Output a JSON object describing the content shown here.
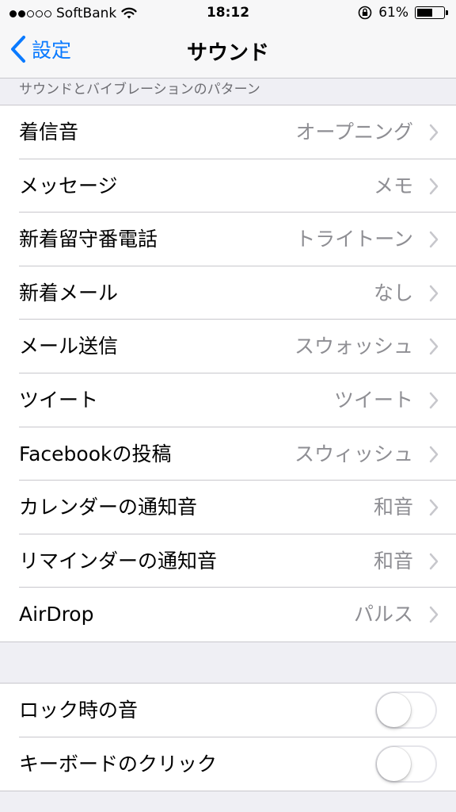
{
  "status_bar": {
    "signal_dots": [
      true,
      true,
      false,
      false,
      false
    ],
    "carrier": "SoftBank",
    "time": "18:12",
    "battery_percent": "61%",
    "battery_level": 0.61,
    "icons": [
      "wifi-icon",
      "rotation-lock-icon",
      "battery-icon"
    ]
  },
  "nav": {
    "back_label": "設定",
    "title": "サウンド"
  },
  "section_header": "サウンドとバイブレーションのパターン",
  "sound_rows": [
    {
      "label": "着信音",
      "value": "オープニング"
    },
    {
      "label": "メッセージ",
      "value": "メモ"
    },
    {
      "label": "新着留守番電話",
      "value": "トライトーン"
    },
    {
      "label": "新着メール",
      "value": "なし"
    },
    {
      "label": "メール送信",
      "value": "スウォッシュ"
    },
    {
      "label": "ツイート",
      "value": "ツイート"
    },
    {
      "label": "Facebookの投稿",
      "value": "スウィッシュ"
    },
    {
      "label": "カレンダーの通知音",
      "value": "和音"
    },
    {
      "label": "リマインダーの通知音",
      "value": "和音"
    },
    {
      "label": "AirDrop",
      "value": "パルス"
    }
  ],
  "toggle_rows": [
    {
      "label": "ロック時の音",
      "on": false
    },
    {
      "label": "キーボードのクリック",
      "on": false
    }
  ],
  "colors": {
    "accent": "#0a7aff",
    "background": "#efeff4",
    "value_text": "#8e8e93",
    "separator": "#c8c7cc"
  }
}
